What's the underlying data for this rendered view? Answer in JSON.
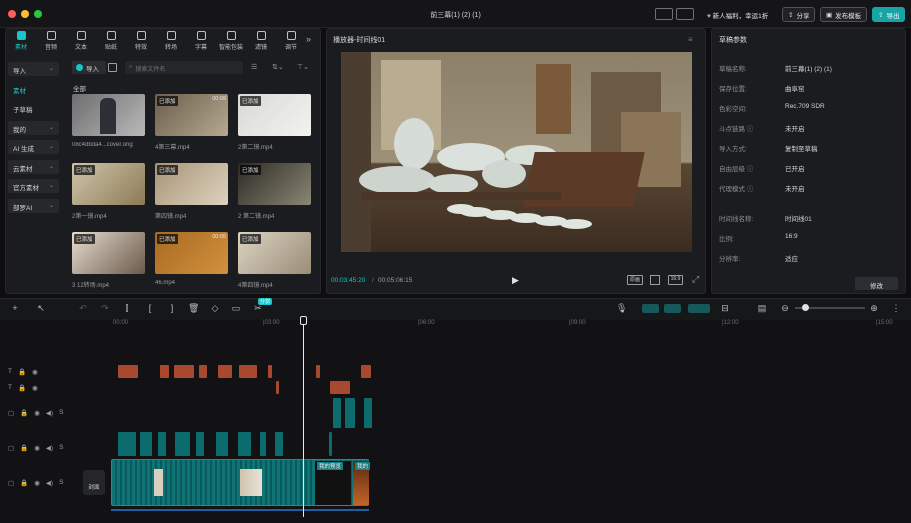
{
  "window": {
    "title": "前三幕(1) (2) (1)",
    "buttons": {
      "promo": "新人福利，幸运1折",
      "share": "分享",
      "publish_template": "发布模板",
      "export": "导出"
    }
  },
  "media_tabs": [
    {
      "label": "素材",
      "icon": "media-icon"
    },
    {
      "label": "音频",
      "icon": "audio-icon"
    },
    {
      "label": "文本",
      "icon": "text-icon"
    },
    {
      "label": "贴纸",
      "icon": "sticker-icon"
    },
    {
      "label": "特效",
      "icon": "effects-icon"
    },
    {
      "label": "转场",
      "icon": "transition-icon"
    },
    {
      "label": "字幕",
      "icon": "caption-icon"
    },
    {
      "label": "智能包装",
      "icon": "smart-pack-icon"
    },
    {
      "label": "滤镜",
      "icon": "filter-icon"
    },
    {
      "label": "调节",
      "icon": "adjust-icon"
    }
  ],
  "more_tabs": "»",
  "categories": [
    {
      "label": "导入",
      "has_chevron": true
    },
    {
      "label": "素材",
      "has_chevron": false
    },
    {
      "label": "子草稿",
      "has_chevron": false
    },
    {
      "label": "我的",
      "has_chevron": true
    },
    {
      "label": "AI 生成",
      "has_chevron": true
    },
    {
      "label": "云素材",
      "has_chevron": true
    },
    {
      "label": "官方素材",
      "has_chevron": true
    },
    {
      "label": "部罗AI",
      "has_chevron": true
    }
  ],
  "media_toolbar": {
    "import_label": "导入",
    "search_placeholder": "搜索文件名",
    "section_all": "全部"
  },
  "media_items": [
    {
      "name": "08c4dbda4...cover.orig",
      "badge": "",
      "duration": "",
      "colors": [
        "#6e6e70",
        "#b9b9b9"
      ]
    },
    {
      "name": "4第三幕.mp4",
      "badge": "已添加",
      "duration": "00:09",
      "colors": [
        "#6a5e4d",
        "#b6a98f"
      ]
    },
    {
      "name": "2第二镜.mp4",
      "badge": "已添加",
      "duration": "",
      "colors": [
        "#d9d9d6",
        "#f2f2ef"
      ]
    },
    {
      "name": "2第一镜.mp4",
      "badge": "已添加",
      "duration": "",
      "colors": [
        "#cfc5ab",
        "#8d7a55"
      ]
    },
    {
      "name": "第四镜.mp4",
      "badge": "已添加",
      "duration": "",
      "colors": [
        "#a89478",
        "#ddd2bd"
      ]
    },
    {
      "name": "2 第二镜.mp4",
      "badge": "已添加",
      "duration": "",
      "colors": [
        "#2d2a25",
        "#8a8774"
      ]
    },
    {
      "name": "3 12转场.mp4",
      "badge": "已添加",
      "duration": "",
      "colors": [
        "#e6ddd0",
        "#6b5a4a"
      ]
    },
    {
      "name": "46.mp4",
      "badge": "已添加",
      "duration": "00:05",
      "colors": [
        "#a86a22",
        "#d3913e"
      ]
    },
    {
      "name": "4第四镜.mp4",
      "badge": "已添加",
      "duration": "",
      "colors": [
        "#dcd4c3",
        "#9a8d78"
      ]
    }
  ],
  "player": {
    "title": "播放器-时间线01",
    "current_time": "00:03:45:20",
    "total_time": "00:05:06:15",
    "ratio": "16:9",
    "hd_label": "原画"
  },
  "draft": {
    "title": "草稿参数",
    "fields": [
      {
        "key": "草稿名称:",
        "value": "前三幕(1) (2) (1)"
      },
      {
        "key": "保存位置:",
        "value": "曲阜窑"
      },
      {
        "key": "色彩空间:",
        "value": "Rec.709 SDR"
      },
      {
        "key": "斗点链路 ⓘ",
        "value": "未开启"
      },
      {
        "key": "导入方式:",
        "value": "复制至草稿"
      },
      {
        "key": "自由层级 ⓘ",
        "value": "已开启"
      },
      {
        "key": "代理模式 ⓘ",
        "value": "未开启"
      },
      {
        "key": "时间线名称:",
        "value": "时间线01"
      },
      {
        "key": "比例:",
        "value": "16:9"
      },
      {
        "key": "分辨率:",
        "value": "适应"
      }
    ],
    "edit_button": "修改"
  },
  "timeline": {
    "ticks": [
      "00:00",
      "|03:00",
      "|06:00",
      "|09:00",
      "|12:00",
      "|15:00"
    ],
    "cover_label": "封面",
    "split_tooltip": "分割",
    "track_icons": [
      "T",
      "T",
      "▢",
      "▢",
      "▢"
    ],
    "clip_labels": [
      "我的预览",
      "我的"
    ]
  },
  "colors": {
    "accent": "#18c6c9",
    "subtitle_clip": "#a8482f",
    "audio_clip": "#0c6b6c"
  }
}
